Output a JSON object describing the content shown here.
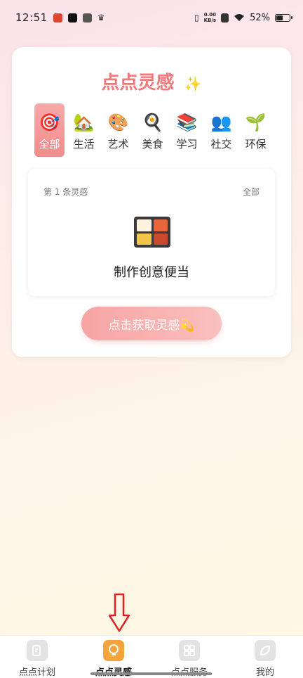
{
  "status_bar": {
    "time": "12:51",
    "net_speed_value": "0.00",
    "net_speed_unit": "KB/s",
    "battery": "52%",
    "battery_level": 0.52
  },
  "card": {
    "title": "点点灵感",
    "title_emoji": "✨",
    "categories": [
      {
        "icon": "🎯",
        "label": "全部",
        "active": true
      },
      {
        "icon": "🏡",
        "label": "生活"
      },
      {
        "icon": "🎨",
        "label": "艺术"
      },
      {
        "icon": "🍳",
        "label": "美食"
      },
      {
        "icon": "📚",
        "label": "学习"
      },
      {
        "icon": "👥",
        "label": "社交"
      },
      {
        "icon": "🌱",
        "label": "环保"
      }
    ],
    "idea": {
      "count_label": "第 1 条灵感",
      "category": "全部",
      "icon": "bento-box-icon",
      "text": "制作创意便当"
    },
    "button_label": "点击获取灵感💫"
  },
  "bottom_nav": [
    {
      "label": "点点计划",
      "icon": "plan-icon"
    },
    {
      "label": "点点灵感",
      "icon": "bulb-icon",
      "active": true
    },
    {
      "label": "点点服务",
      "icon": "grid-icon"
    },
    {
      "label": "我的",
      "icon": "leaf-icon"
    }
  ],
  "colors": {
    "accent": "#f07a7a",
    "nav_active": "#f5a33c",
    "annotation_arrow": "#e02020"
  }
}
